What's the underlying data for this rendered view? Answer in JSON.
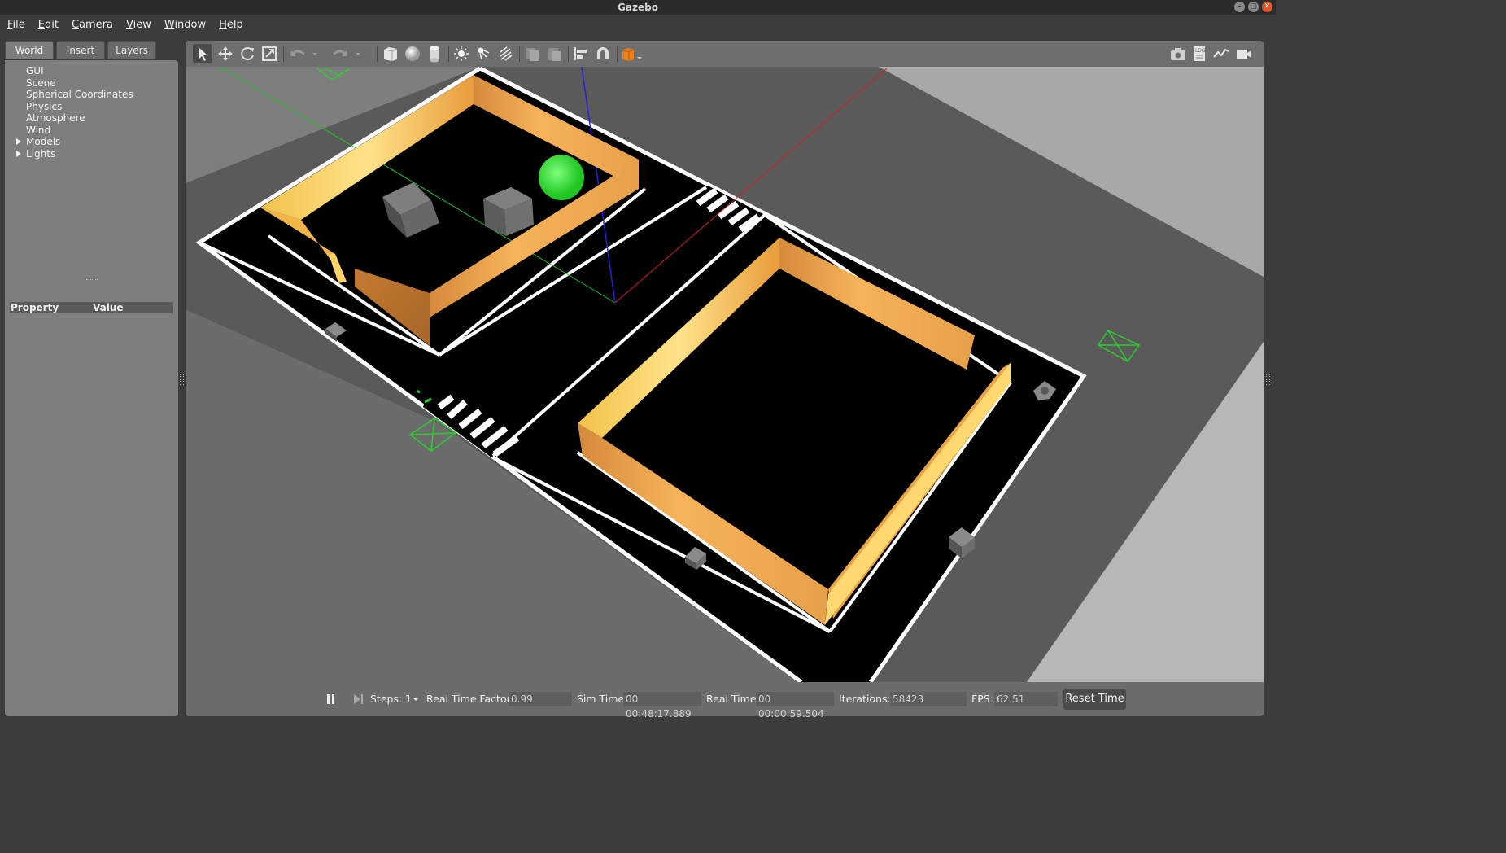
{
  "window": {
    "title": "Gazebo"
  },
  "menu": [
    "File",
    "Edit",
    "Camera",
    "View",
    "Window",
    "Help"
  ],
  "left_panel": {
    "tabs": [
      "World",
      "Insert",
      "Layers"
    ],
    "active_tab": "World",
    "tree": [
      {
        "label": "GUI",
        "expandable": false
      },
      {
        "label": "Scene",
        "expandable": false
      },
      {
        "label": "Spherical Coordinates",
        "expandable": false
      },
      {
        "label": "Physics",
        "expandable": false
      },
      {
        "label": "Atmosphere",
        "expandable": false
      },
      {
        "label": "Wind",
        "expandable": false
      },
      {
        "label": "Models",
        "expandable": true
      },
      {
        "label": "Lights",
        "expandable": true
      }
    ],
    "property_header": {
      "property": "Property",
      "value": "Value"
    }
  },
  "toolbar": {
    "tools": [
      "select-mode",
      "translate-mode",
      "rotate-mode",
      "scale-mode",
      "undo",
      "redo",
      "box",
      "sphere",
      "cylinder",
      "point-light",
      "spot-light",
      "directional-light",
      "copy",
      "paste",
      "align",
      "snap",
      "change-view"
    ],
    "right_tools": [
      "screenshot",
      "log",
      "plot",
      "video-record"
    ]
  },
  "status": {
    "steps_label": "Steps:",
    "steps_value": "1",
    "rtf_label": "Real Time Factor:",
    "rtf_value": "0.99",
    "sim_time_label": "Sim Time:",
    "sim_time_value": "00 00:48:17.889",
    "real_time_label": "Real Time:",
    "real_time_value": "00 00:00:59.504",
    "iterations_label": "Iterations:",
    "iterations_value": "58423",
    "fps_label": "FPS:",
    "fps_value": "62.51",
    "reset_label": "Reset Time"
  },
  "colors": {
    "wall": "#e8a445",
    "ground": "#000000",
    "marker": "#2ecc2e",
    "sphere": "#3fe23f",
    "axis_x": "#d02020",
    "axis_y": "#20b020",
    "axis_z": "#2020d0"
  }
}
